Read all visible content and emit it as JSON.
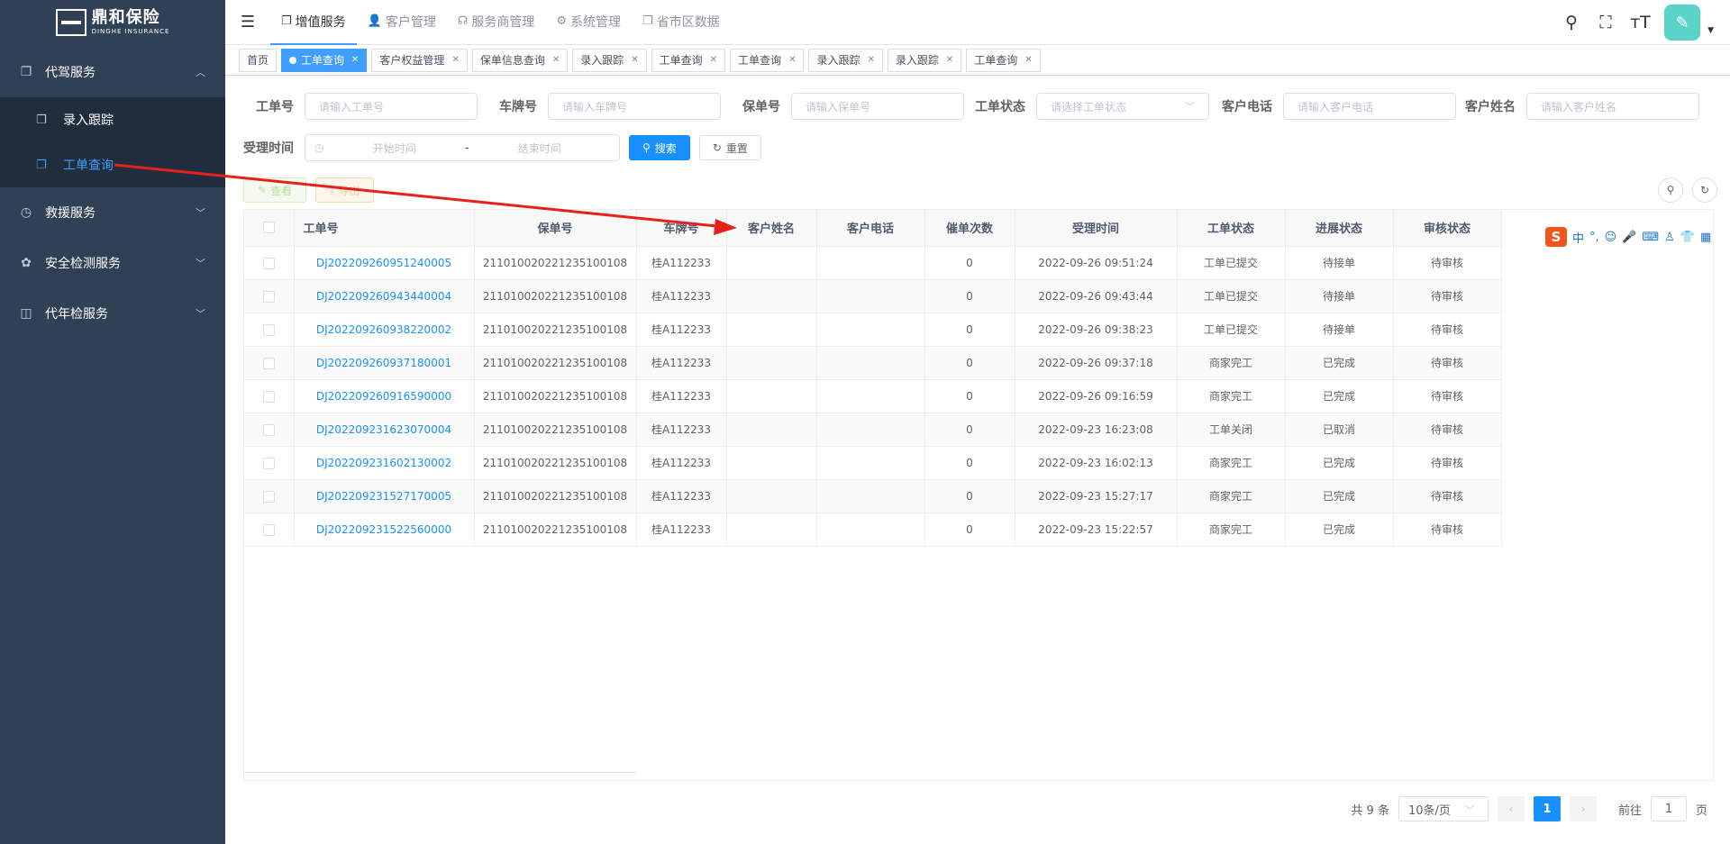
{
  "brand": {
    "name_cn": "鼎和保险",
    "name_en": "DINGHE INSURANCE"
  },
  "sidebar": {
    "groups": [
      {
        "label": "代驾服务",
        "icon": "copy-icon",
        "expanded": true,
        "items": [
          {
            "label": "录入跟踪",
            "active": false
          },
          {
            "label": "工单查询",
            "active": true
          }
        ]
      },
      {
        "label": "救援服务",
        "icon": "clock-icon",
        "expanded": false
      },
      {
        "label": "安全检测服务",
        "icon": "settings-icon",
        "expanded": false
      },
      {
        "label": "代年检服务",
        "icon": "book-icon",
        "expanded": false
      }
    ]
  },
  "topnav": {
    "items": [
      {
        "label": "增值服务",
        "active": true
      },
      {
        "label": "客户管理",
        "active": false
      },
      {
        "label": "服务商管理",
        "active": false
      },
      {
        "label": "系统管理",
        "active": false
      },
      {
        "label": "省市区数据",
        "active": false
      }
    ]
  },
  "tags": [
    {
      "label": "首页",
      "active": false,
      "closable": false
    },
    {
      "label": "工单查询",
      "active": true,
      "closable": true
    },
    {
      "label": "客户权益管理",
      "active": false,
      "closable": true
    },
    {
      "label": "保单信息查询",
      "active": false,
      "closable": true
    },
    {
      "label": "录入跟踪",
      "active": false,
      "closable": true
    },
    {
      "label": "工单查询",
      "active": false,
      "closable": true
    },
    {
      "label": "工单查询",
      "active": false,
      "closable": true
    },
    {
      "label": "录入跟踪",
      "active": false,
      "closable": true
    },
    {
      "label": "录入跟踪",
      "active": false,
      "closable": true
    },
    {
      "label": "工单查询",
      "active": false,
      "closable": true
    }
  ],
  "form": {
    "order_no": {
      "label": "工单号",
      "placeholder": "请输入工单号"
    },
    "plate": {
      "label": "车牌号",
      "placeholder": "请输入车牌号"
    },
    "policy": {
      "label": "保单号",
      "placeholder": "请输入保单号"
    },
    "status": {
      "label": "工单状态",
      "placeholder": "请选择工单状态"
    },
    "phone": {
      "label": "客户电话",
      "placeholder": "请输入客户电话"
    },
    "name": {
      "label": "客户姓名",
      "placeholder": "请输入客户姓名"
    },
    "date": {
      "label": "受理时间",
      "start": "开始时间",
      "sep": "-",
      "end": "结束时间"
    },
    "search_label": "搜索",
    "reset_label": "重置"
  },
  "actions": {
    "view_label": "查看",
    "export_label": "导出"
  },
  "table": {
    "columns": [
      "工单号",
      "保单号",
      "车牌号",
      "客户姓名",
      "客户电话",
      "催单次数",
      "受理时间",
      "工单状态",
      "进展状态",
      "审核状态"
    ],
    "rows": [
      [
        "DJ202209260951240005",
        "211010020221235100108",
        "桂A112233",
        "",
        "",
        "0",
        "2022-09-26 09:51:24",
        "工单已提交",
        "待接单",
        "待审核"
      ],
      [
        "DJ202209260943440004",
        "211010020221235100108",
        "桂A112233",
        "",
        "",
        "0",
        "2022-09-26 09:43:44",
        "工单已提交",
        "待接单",
        "待审核"
      ],
      [
        "DJ202209260938220002",
        "211010020221235100108",
        "桂A112233",
        "",
        "",
        "0",
        "2022-09-26 09:38:23",
        "工单已提交",
        "待接单",
        "待审核"
      ],
      [
        "DJ202209260937180001",
        "211010020221235100108",
        "桂A112233",
        "",
        "",
        "0",
        "2022-09-26 09:37:18",
        "商家完工",
        "已完成",
        "待审核"
      ],
      [
        "DJ202209260916590000",
        "211010020221235100108",
        "桂A112233",
        "",
        "",
        "0",
        "2022-09-26 09:16:59",
        "商家完工",
        "已完成",
        "待审核"
      ],
      [
        "DJ202209231623070004",
        "211010020221235100108",
        "桂A112233",
        "",
        "",
        "0",
        "2022-09-23 16:23:08",
        "工单关闭",
        "已取消",
        "待审核"
      ],
      [
        "DJ202209231602130002",
        "211010020221235100108",
        "桂A112233",
        "",
        "",
        "0",
        "2022-09-23 16:02:13",
        "商家完工",
        "已完成",
        "待审核"
      ],
      [
        "DJ202209231527170005",
        "211010020221235100108",
        "桂A112233",
        "",
        "",
        "0",
        "2022-09-23 15:27:17",
        "商家完工",
        "已完成",
        "待审核"
      ],
      [
        "DJ202209231522560000",
        "211010020221235100108",
        "桂A112233",
        "",
        "",
        "0",
        "2022-09-23 15:22:57",
        "商家完工",
        "已完成",
        "待审核"
      ]
    ]
  },
  "pagination": {
    "total": "共 9 条",
    "page_size": "10条/页",
    "current": "1",
    "goto_prefix": "前往",
    "goto_value": "1",
    "goto_suffix": "页"
  },
  "ime": {
    "lang": "中",
    "punct": "°,"
  },
  "colors": {
    "sidebar_bg": "#304156",
    "submenu_bg": "#1f2d3d",
    "primary": "#1890ff",
    "annotation_arrow": "#e8201a"
  }
}
